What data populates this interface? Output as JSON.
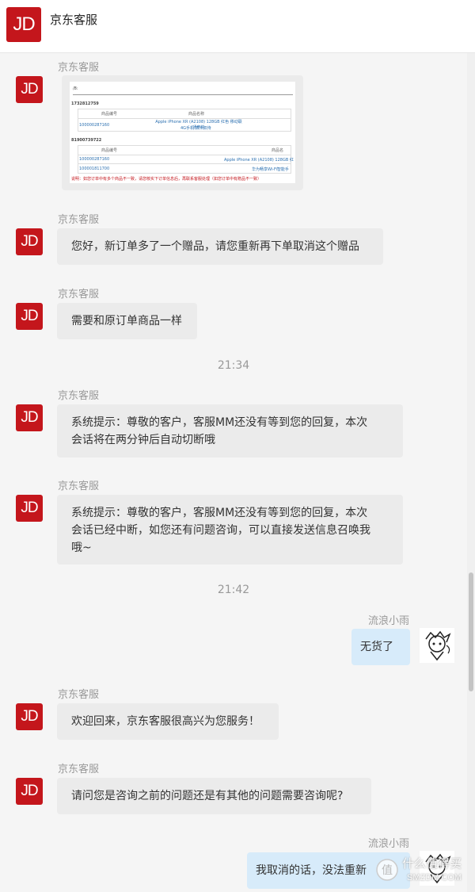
{
  "header": {
    "logo_text": "JD",
    "title": "京东客服"
  },
  "messages": [
    {
      "sender": "京东客服",
      "type": "image"
    },
    {
      "sender": "京东客服",
      "text": "您好，新订单多了一个赠品，请您重新再下单取消这个赠品"
    },
    {
      "sender": "京东客服",
      "text": "需要和原订单商品一样"
    },
    {
      "sender": "京东客服",
      "text_lines": [
        "系统提示：尊敬的客户，客服MM还没有等到您的回复，本次",
        "会话将在两分钟后自动切断哦"
      ]
    },
    {
      "sender": "京东客服",
      "text_lines": [
        "系统提示：尊敬的客户，客服MM还没有等到您的回复，本次",
        "会话已经中断，如您还有问题咨询，可以直接发送信息召唤我",
        "哦~"
      ]
    },
    {
      "sender": "流浪小雨",
      "text": "无货了"
    },
    {
      "sender": "京东客服",
      "text": "欢迎回来，京东客服很高兴为您服务！"
    },
    {
      "sender": "京东客服",
      "text": "请问您是咨询之前的问题还是有其他的问题需要咨询呢?"
    },
    {
      "sender": "流浪小雨",
      "text": "我取消的话，没法重新"
    }
  ],
  "timestamps": [
    "21:34",
    "21:42"
  ],
  "image_card": {
    "title": "/8:",
    "order1": "1732812759",
    "col_headers": [
      "商品编号",
      "商品名称"
    ],
    "row1_id": "100000287160",
    "row1_name": "Apple iPhone XR (A2108) 128GB 红色 移动联通电信",
    "row1_name2": "4G手机 双卡双待",
    "order2": "81900739722",
    "col_headers2": [
      "商品编号",
      "商品名"
    ],
    "row2_id": "100000287160",
    "row2_name": "Apple iPhone XR (A2108) 128GB 红",
    "row3_id": "100001811700",
    "row3_name": "华为畅享Wi-Fi智能手",
    "notice": "说明：如您订单中有多个商品不一致，请您核实下订单信息后，再联系客服处理（如您订单中有赠品不一致）"
  },
  "watermark": {
    "line1": "什么值得买",
    "line2": "SMZDM.COM"
  }
}
